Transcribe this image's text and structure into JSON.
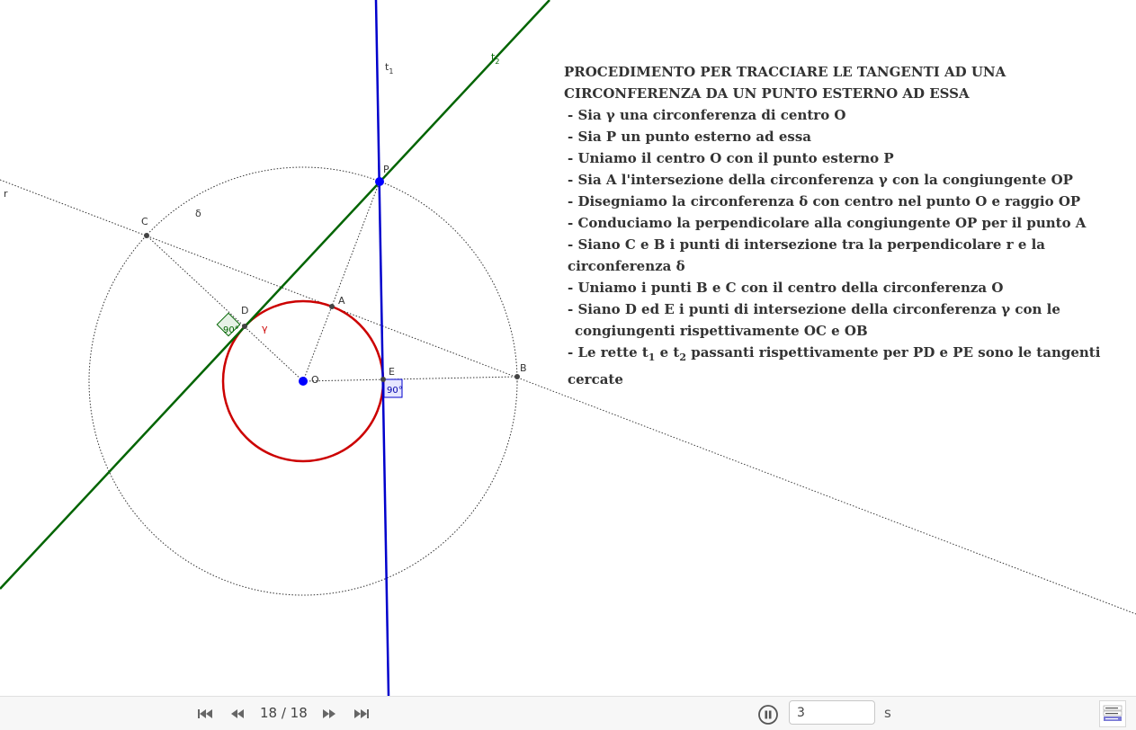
{
  "construction": {
    "labels": {
      "t1": "t",
      "t1_sub": "1",
      "t2": "t",
      "t2_sub": "2",
      "P": "P",
      "C": "C",
      "delta": "δ",
      "r": "r",
      "A": "A",
      "D": "D",
      "gamma": "γ",
      "O": "O",
      "E": "E",
      "B": "B",
      "angle_D": "90°",
      "angle_E": "90°"
    },
    "colors": {
      "tangent_t1": "#0000cc",
      "tangent_t2": "#006400",
      "circle_gamma": "#cc0000",
      "point_blue": "#0000ff",
      "angle_D_fill": "#e6f2e6",
      "angle_E_fill": "#e6e6ff"
    }
  },
  "instructions": {
    "title_line1": "PROCEDIMENTO PER TRACCIARE LE TANGENTI AD UNA",
    "title_line2": "CIRCONFERENZA DA UN PUNTO ESTERNO AD ESSA",
    "steps": [
      "- Sia γ una circonferenza di centro O",
      "- Sia P un punto esterno ad essa",
      "- Uniamo il centro O con il punto esterno P",
      "- Sia A l'intersezione della circonferenza γ con la congiungente OP",
      "- Disegniamo la circonferenza δ con centro nel punto O e raggio OP",
      "- Conduciamo la perpendicolare alla congiungente OP per il punto A",
      "- Siano C e B i punti di intersezione tra la perpendicolare r e la circonferenza δ",
      "- Uniamo i punti B e C con il centro della circonferenza O",
      "- Siano D ed E i punti di intersezione della circonferenza γ con le"
    ],
    "step_continuation": "congiungenti rispettivamente OC e OB",
    "last_step": {
      "prefix": "- Le rette t",
      "sub1": "1",
      "middle": " e t",
      "sub2": "2",
      "suffix": " passanti rispettivamente per PD e PE sono le tangenti cercate"
    }
  },
  "toolbar": {
    "step_counter": "18 / 18",
    "speed_value": "3",
    "speed_unit": "s",
    "buttons": {
      "first": "skip-to-start-icon",
      "previous": "step-back-icon",
      "next": "step-forward-icon",
      "last": "skip-to-end-icon",
      "pause": "pause-icon",
      "algebra": "algebra-view-icon"
    }
  }
}
